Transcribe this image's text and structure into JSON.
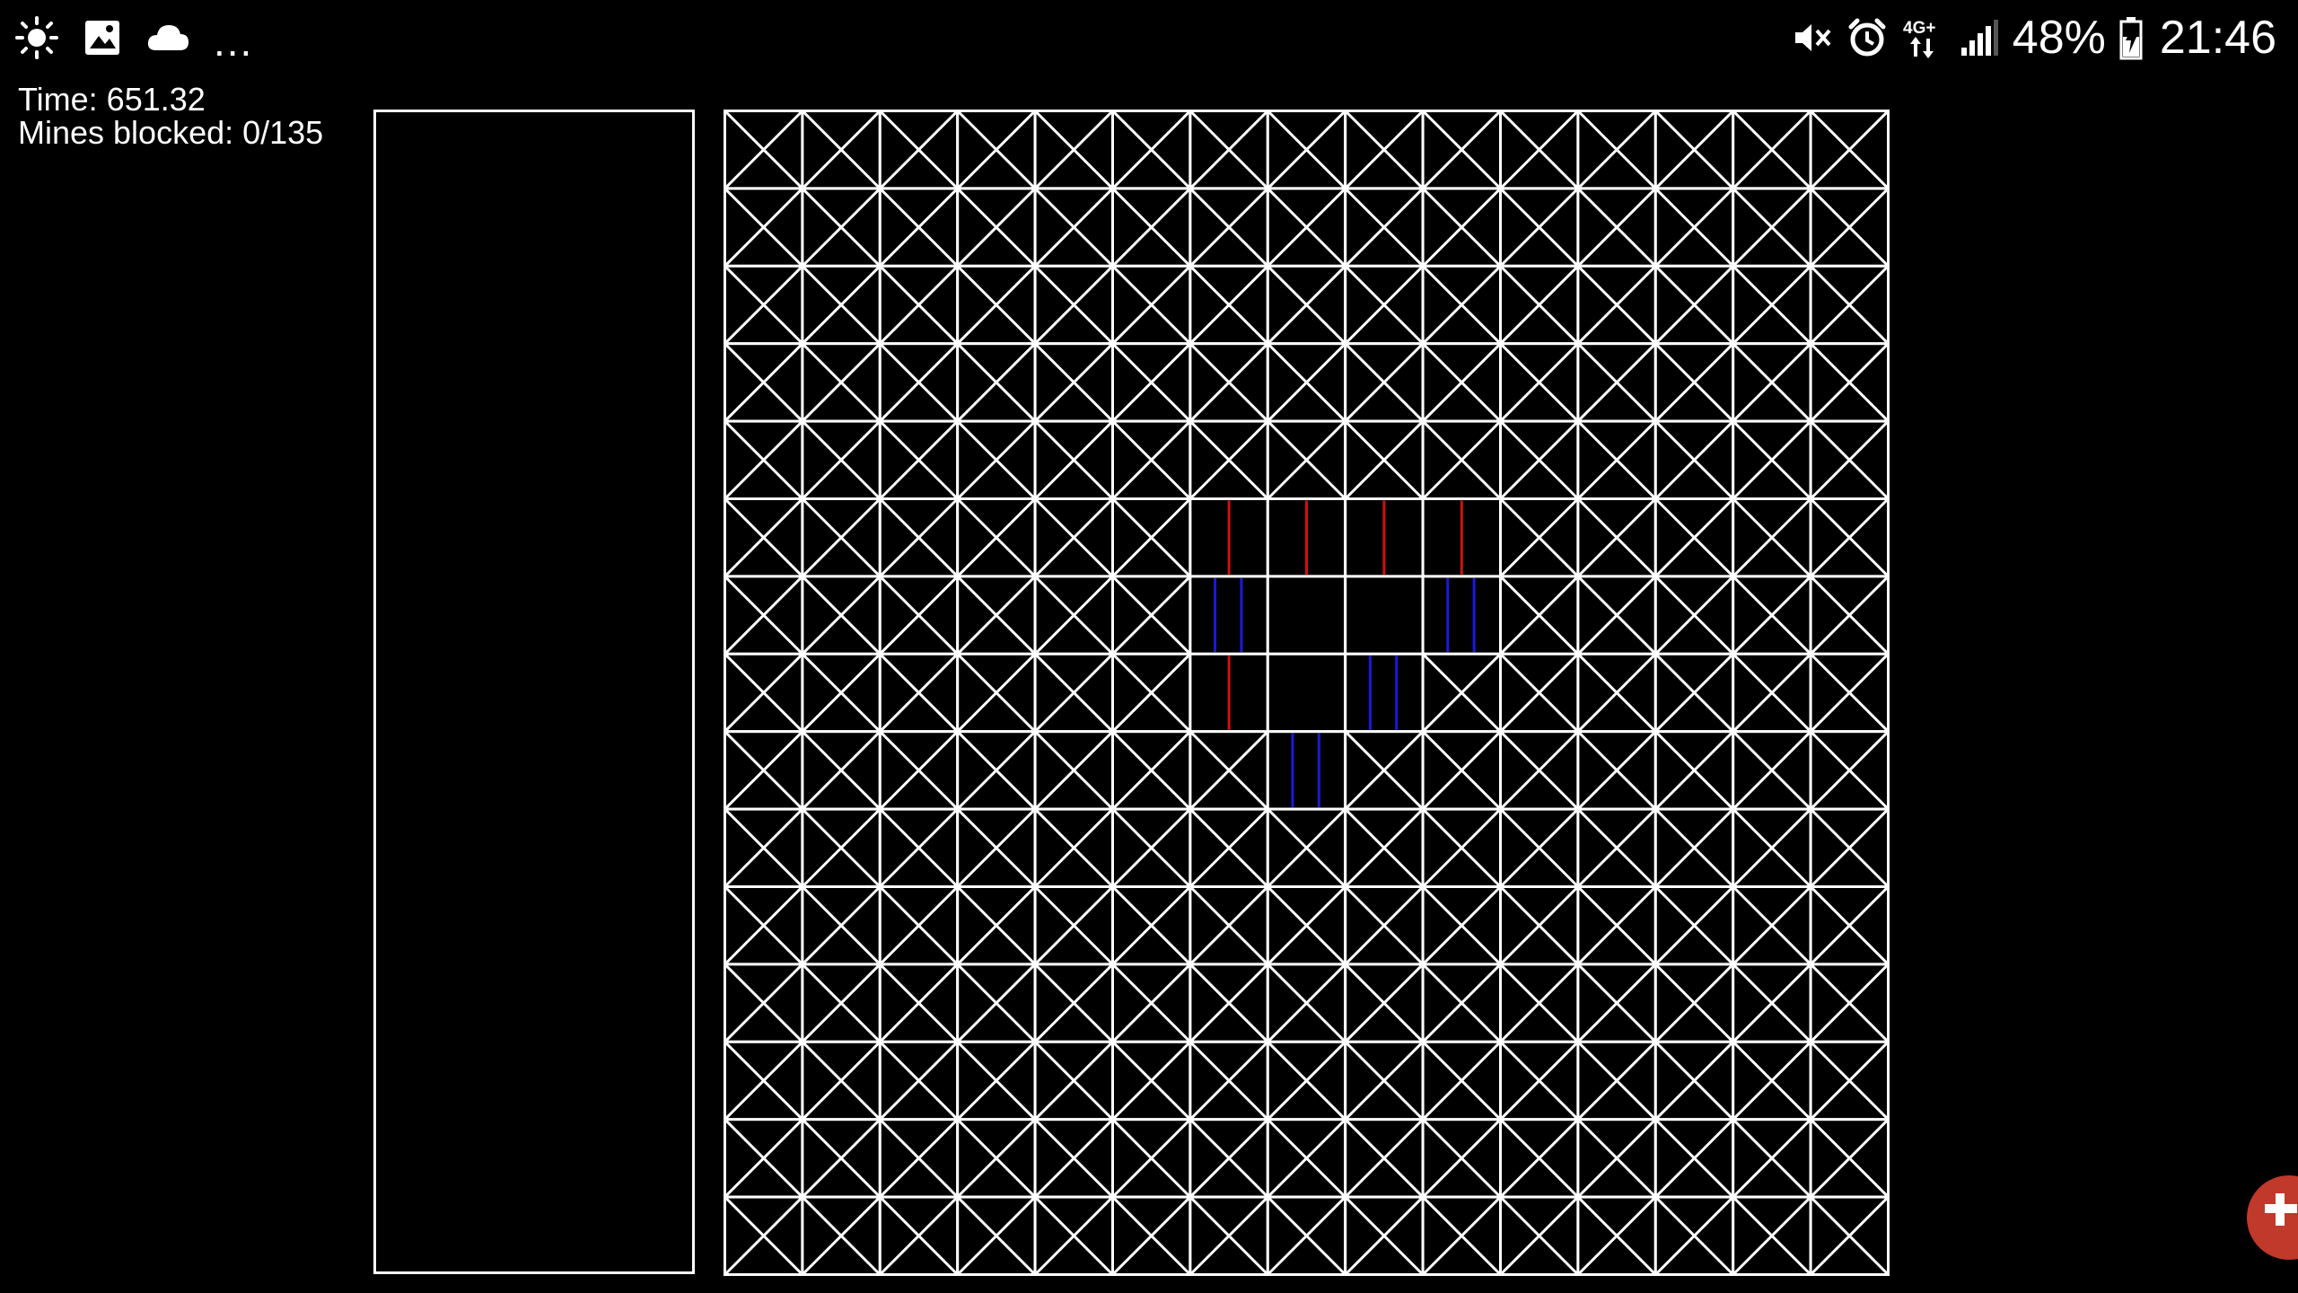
{
  "status_bar": {
    "left_icons": [
      "brightness-icon",
      "image-icon",
      "cloud-icon"
    ],
    "more_indicator": "...",
    "right_icons": [
      "vibrate-icon",
      "alarm-icon",
      "network-4g-icon",
      "signal-icon",
      "battery-icon"
    ],
    "network_label": "4G+",
    "battery_percent": "48%",
    "clock": "21:46"
  },
  "hud": {
    "time_text": "Time: 651.32",
    "mines_text": "Mines blocked: 0/135"
  },
  "board": {
    "rows": 15,
    "cols": 15,
    "colors": {
      "line": "#ffffff",
      "background": "#000000",
      "red_marker": "#d01010",
      "blue_marker": "#1a1ad8"
    },
    "revealed_cells": [
      {
        "r": 5,
        "c": 6,
        "marker": "red"
      },
      {
        "r": 5,
        "c": 7,
        "marker": "red"
      },
      {
        "r": 5,
        "c": 8,
        "marker": "red"
      },
      {
        "r": 5,
        "c": 9,
        "marker": "red"
      },
      {
        "r": 6,
        "c": 6,
        "marker": "blue"
      },
      {
        "r": 6,
        "c": 7,
        "marker": "none"
      },
      {
        "r": 6,
        "c": 8,
        "marker": "none"
      },
      {
        "r": 6,
        "c": 9,
        "marker": "blue"
      },
      {
        "r": 7,
        "c": 6,
        "marker": "red"
      },
      {
        "r": 7,
        "c": 7,
        "marker": "none"
      },
      {
        "r": 7,
        "c": 8,
        "marker": "blue"
      },
      {
        "r": 8,
        "c": 7,
        "marker": "blue"
      }
    ]
  },
  "fab": {
    "icon": "gamepad-icon",
    "color": "#c0392b"
  }
}
